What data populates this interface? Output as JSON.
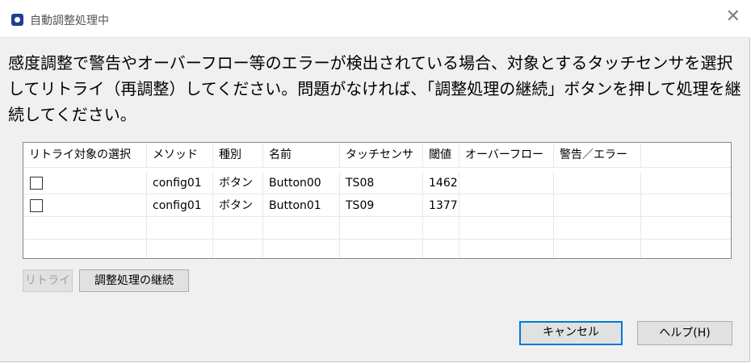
{
  "window": {
    "title": "自動調整処理中",
    "close_glyph": "✕"
  },
  "message": "感度調整で警告やオーバーフロー等のエラーが検出されている場合、対象とするタッチセンサを選択してリトライ（再調整）してください。問題がなければ、「調整処理の継続」ボタンを押して処理を継続してください。",
  "table": {
    "columns": [
      "リトライ対象の選択",
      "メソッド",
      "種別",
      "名前",
      "タッチセンサ",
      "閾値",
      "オーバーフロー",
      "警告／エラー",
      ""
    ],
    "rows": [
      {
        "selected": false,
        "method": "config01",
        "type": "ボタン",
        "name": "Button00",
        "sensor": "TS08",
        "threshold": "1462",
        "overflow": "",
        "warning": ""
      },
      {
        "selected": false,
        "method": "config01",
        "type": "ボタン",
        "name": "Button01",
        "sensor": "TS09",
        "threshold": "1377",
        "overflow": "",
        "warning": ""
      }
    ]
  },
  "buttons": {
    "retry": "リトライ",
    "continue": "調整処理の継続",
    "cancel": "キャンセル",
    "help": "ヘルプ(H)"
  }
}
